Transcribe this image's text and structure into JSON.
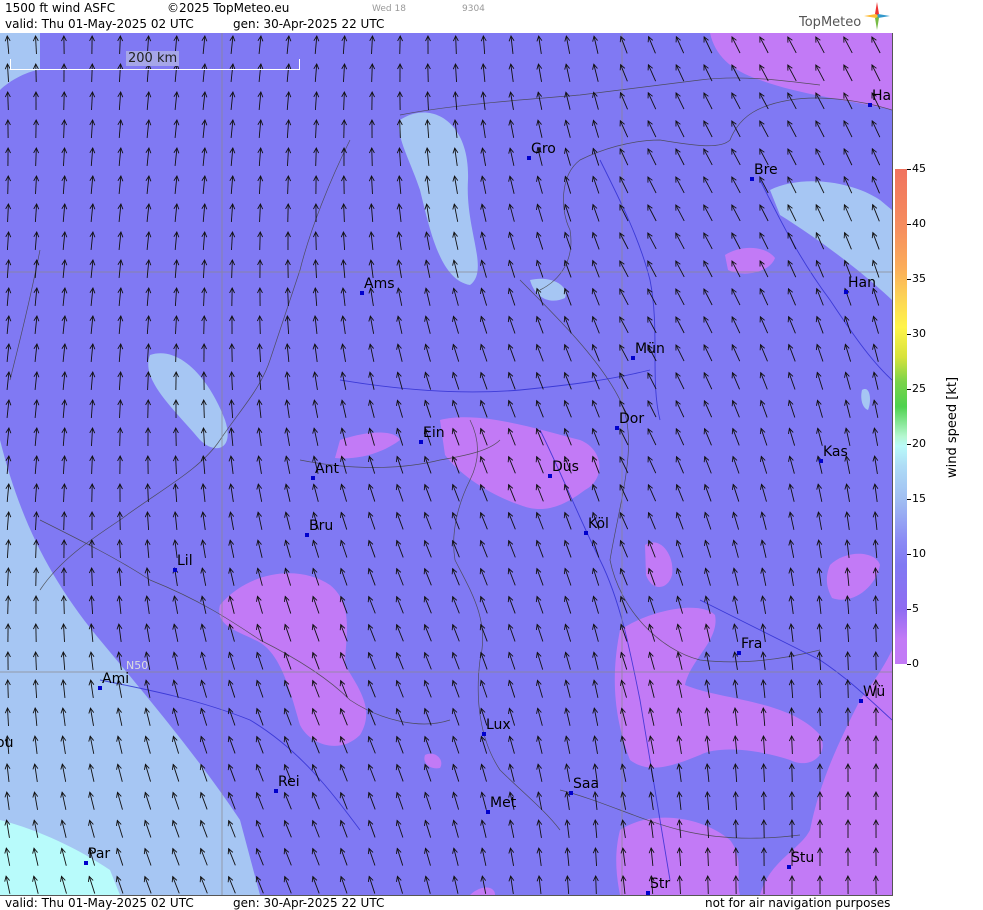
{
  "header": {
    "product": "1500 ft wind ASFC",
    "copyright": "©2025 TopMeteo.eu",
    "small_day": "Wed 18",
    "small_id": "9304",
    "valid": "valid:  Thu  01-May-2025  02 UTC",
    "gen": "gen: 30-Apr-2025 22 UTC",
    "logo_text": "TopMeteo"
  },
  "footer": {
    "valid": "valid:  Thu  01-May-2025  02 UTC",
    "gen": "gen: 30-Apr-2025 22 UTC",
    "disclaimer": "not for air navigation purposes"
  },
  "map": {
    "scale_label": "200 km",
    "lat_label": "N50",
    "cities": [
      {
        "name": "Ha"
      },
      {
        "name": "Gro"
      },
      {
        "name": "Bre"
      },
      {
        "name": "Ams"
      },
      {
        "name": "Han"
      },
      {
        "name": "Mün"
      },
      {
        "name": "Ein"
      },
      {
        "name": "Dor"
      },
      {
        "name": "Ant"
      },
      {
        "name": "Düs"
      },
      {
        "name": "Kas"
      },
      {
        "name": "Bru"
      },
      {
        "name": "Köl"
      },
      {
        "name": "Lil"
      },
      {
        "name": "Fra"
      },
      {
        "name": "Ami"
      },
      {
        "name": "Wü"
      },
      {
        "name": "Lux"
      },
      {
        "name": "ou"
      },
      {
        "name": "Rei"
      },
      {
        "name": "Saa"
      },
      {
        "name": "Met"
      },
      {
        "name": "Par"
      },
      {
        "name": "Stu"
      },
      {
        "name": "Str"
      }
    ]
  },
  "legend": {
    "unit": "wind  speed  [kt]",
    "ticks": [
      "45",
      "40",
      "35",
      "30",
      "25",
      "20",
      "15",
      "10",
      "5",
      "0"
    ]
  },
  "colors": {
    "calm": "#c27af6",
    "base": "#8079f3",
    "light": "#a6c6f3",
    "cyan": "#b8fbfb",
    "city_marker": "#0000cc"
  }
}
